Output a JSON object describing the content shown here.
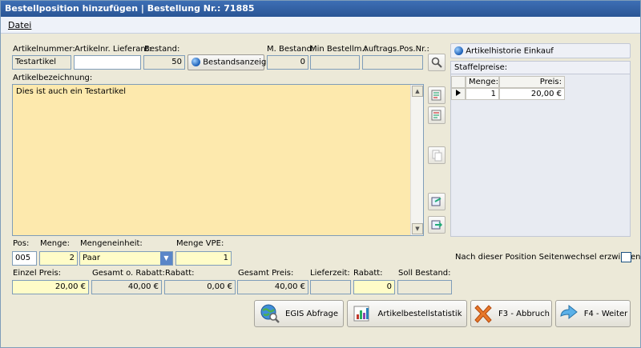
{
  "window": {
    "title": "Bestellposition hinzufügen  |  Bestellung Nr.: 71885"
  },
  "menu": {
    "file": "Datei"
  },
  "row1": {
    "artikelnummer_label": "Artikelnummer:",
    "artikelnummer_value": "Testartikel",
    "lieferant_label": "Artikelnr. Lieferant:",
    "lieferant_value": "",
    "bestand_label": "Bestand:",
    "bestand_value": "50",
    "bestandsanzeige_button": "Bestandsanzeige",
    "m_bestand_label": "M. Bestand:",
    "m_bestand_value": "0",
    "min_bestellm_label": "Min Bestellm.:",
    "min_bestellm_value": "",
    "auftrags_label": "Auftrags.Pos.Nr.:",
    "auftrags_value": ""
  },
  "bezeichnung": {
    "label": "Artikelbezeichnung:",
    "value": "Dies ist auch ein Testartikel"
  },
  "history": {
    "button": "Artikelhistorie Einkauf",
    "staffel_label": "Staffelpreise:",
    "columns": [
      "Menge:",
      "Preis:"
    ],
    "rows": [
      {
        "menge": "1",
        "preis": "20,00 €"
      }
    ]
  },
  "row3": {
    "pos_label": "Pos:",
    "pos_value": "005",
    "menge_label": "Menge:",
    "menge_value": "2",
    "einheit_label": "Mengeneinheit:",
    "einheit_value": "Paar",
    "vpe_label": "Menge VPE:",
    "vpe_value": "1"
  },
  "seitenwechsel_label": "Nach dieser Position Seitenwechsel erzwingen",
  "row4": {
    "einzel_label": "Einzel Preis:",
    "einzel_value": "20,00 €",
    "gesamt_o_label": "Gesamt o. Rabatt:",
    "gesamt_o_value": "40,00 €",
    "rabatt1_label": "Rabatt:",
    "rabatt1_value": "0,00 €",
    "gesamt_label": "Gesamt Preis:",
    "gesamt_value": "40,00 €",
    "lieferzeit_label": "Lieferzeit:",
    "lieferzeit_value": "",
    "rabatt2_label": "Rabatt:",
    "rabatt2_value": "0",
    "soll_label": "Soll Bestand:",
    "soll_value": ""
  },
  "buttons": {
    "egis": "EGIS Abfrage",
    "statistik": "Artikelbestellstatistik",
    "abbruch": "F3 - Abbruch",
    "weiter": "F4 - Weiter"
  }
}
